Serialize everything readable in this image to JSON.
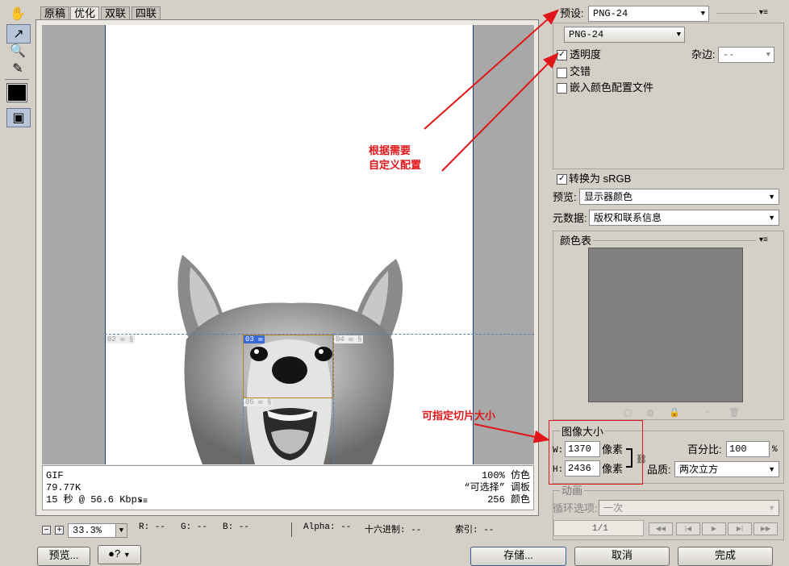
{
  "tabs": [
    "原稿",
    "优化",
    "双联",
    "四联"
  ],
  "active_tab": 1,
  "slices": {
    "s02": "02",
    "s03": "03",
    "s04": "04",
    "s05": "05"
  },
  "info": {
    "format": "GIF",
    "size": "79.77K",
    "time": "15 秒 @ 56.6 Kbps",
    "dither": "100% 仿色",
    "palette": "“可选择” 调板",
    "colors": "256 颜色"
  },
  "status": {
    "zoom": "33.3%",
    "r": "R: --",
    "g": "G: --",
    "b": "B: --",
    "alpha": "Alpha: --",
    "hex": "十六进制: --",
    "index": "索引: --"
  },
  "buttons": {
    "preview": "预览...",
    "save": "存储...",
    "cancel": "取消",
    "done": "完成"
  },
  "settings": {
    "preset_label": "预设:",
    "preset_value": "PNG-24",
    "format_value": "PNG-24",
    "transparency": "透明度",
    "matte_label": "杂边:",
    "matte_value": "--",
    "interlaced": "交错",
    "embed_profile": "嵌入颜色配置文件",
    "convert_srgb": "转换为 sRGB",
    "preview_label": "预览:",
    "preview_value": "显示器颜色",
    "metadata_label": "元数据:",
    "metadata_value": "版权和联系信息"
  },
  "color_table": {
    "title": "颜色表"
  },
  "image_size": {
    "title": "图像大小",
    "w_label": "W:",
    "w_value": "1370",
    "h_label": "H:",
    "h_value": "2436",
    "unit": "像素",
    "percent_label": "百分比:",
    "percent_value": "100",
    "percent_sign": "%",
    "quality_label": "品质:",
    "quality_value": "两次立方"
  },
  "animation": {
    "title": "动画",
    "loop_label": "循环选项:",
    "loop_value": "一次",
    "frame_counter": "1/1"
  },
  "annotations": {
    "note1_line1": "根据需要",
    "note1_line2": "自定义配置",
    "note2": "可指定切片大小"
  },
  "colors": {
    "annotation": "#e0161a",
    "slice_selected": "#b8860b",
    "slice_guide": "#5a7ab8",
    "color_table_bg": "#808080"
  }
}
